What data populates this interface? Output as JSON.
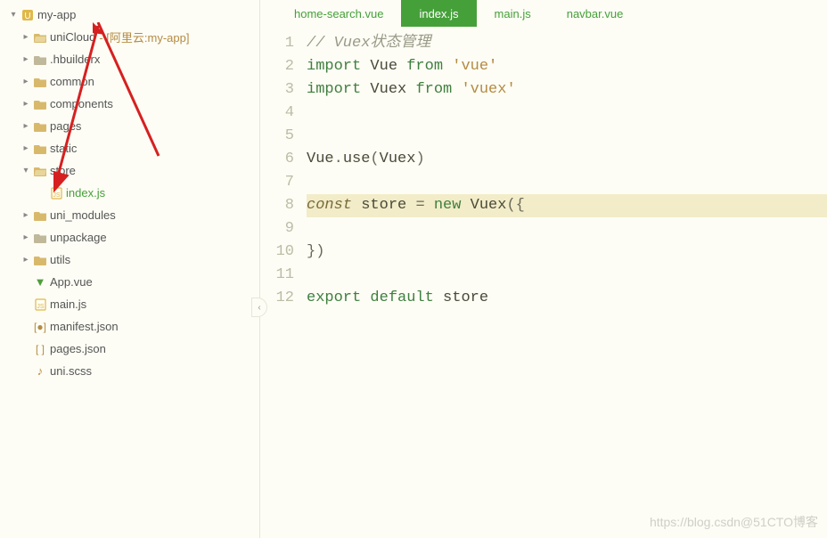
{
  "sidebar": {
    "root": {
      "label": "my-app"
    },
    "items": [
      {
        "label": "uniCloud",
        "suffix": " - [阿里云:my-app]",
        "type": "folder-open",
        "chev": "right"
      },
      {
        "label": ".hbuilderx",
        "type": "folder-grey",
        "chev": "right"
      },
      {
        "label": "common",
        "type": "folder",
        "chev": "right"
      },
      {
        "label": "components",
        "type": "folder",
        "chev": "right"
      },
      {
        "label": "pages",
        "type": "folder",
        "chev": "right"
      },
      {
        "label": "static",
        "type": "folder",
        "chev": "right"
      },
      {
        "label": "store",
        "type": "folder-open",
        "chev": "down",
        "children": [
          {
            "label": "index.js",
            "type": "js",
            "active": true
          }
        ]
      },
      {
        "label": "uni_modules",
        "type": "folder",
        "chev": "right"
      },
      {
        "label": "unpackage",
        "type": "folder-grey",
        "chev": "right"
      },
      {
        "label": "utils",
        "type": "folder",
        "chev": "right"
      },
      {
        "label": "App.vue",
        "type": "vue"
      },
      {
        "label": "main.js",
        "type": "js"
      },
      {
        "label": "manifest.json",
        "type": "manifest"
      },
      {
        "label": "pages.json",
        "type": "json"
      },
      {
        "label": "uni.scss",
        "type": "scss"
      }
    ]
  },
  "tabs": [
    {
      "label": "home-search.vue",
      "active": false
    },
    {
      "label": "index.js",
      "active": true
    },
    {
      "label": "main.js",
      "active": false
    },
    {
      "label": "navbar.vue",
      "active": false
    }
  ],
  "code": {
    "highlight_line": 8,
    "lines": [
      {
        "n": 1,
        "tokens": [
          [
            "comment",
            "// Vuex状态管理"
          ]
        ]
      },
      {
        "n": 2,
        "tokens": [
          [
            "keyword",
            "import"
          ],
          [
            "space",
            " "
          ],
          [
            "ident",
            "Vue"
          ],
          [
            "space",
            " "
          ],
          [
            "keyword",
            "from"
          ],
          [
            "space",
            " "
          ],
          [
            "string",
            "'vue'"
          ]
        ]
      },
      {
        "n": 3,
        "tokens": [
          [
            "keyword",
            "import"
          ],
          [
            "space",
            " "
          ],
          [
            "ident",
            "Vuex"
          ],
          [
            "space",
            " "
          ],
          [
            "keyword",
            "from"
          ],
          [
            "space",
            " "
          ],
          [
            "string",
            "'vuex'"
          ]
        ]
      },
      {
        "n": 4,
        "tokens": []
      },
      {
        "n": 5,
        "tokens": []
      },
      {
        "n": 6,
        "tokens": [
          [
            "ident",
            "Vue"
          ],
          [
            "punct",
            "."
          ],
          [
            "ident",
            "use"
          ],
          [
            "punct",
            "("
          ],
          [
            "ident",
            "Vuex"
          ],
          [
            "punct",
            ")"
          ]
        ]
      },
      {
        "n": 7,
        "tokens": []
      },
      {
        "n": 8,
        "tokens": [
          [
            "const",
            "const"
          ],
          [
            "space",
            " "
          ],
          [
            "ident",
            "store"
          ],
          [
            "space",
            " "
          ],
          [
            "punct",
            "="
          ],
          [
            "space",
            " "
          ],
          [
            "keyword",
            "new"
          ],
          [
            "space",
            " "
          ],
          [
            "ident",
            "Vuex"
          ],
          [
            "punct",
            "({"
          ]
        ]
      },
      {
        "n": 9,
        "tokens": []
      },
      {
        "n": 10,
        "tokens": [
          [
            "punct",
            "})"
          ]
        ]
      },
      {
        "n": 11,
        "tokens": []
      },
      {
        "n": 12,
        "tokens": [
          [
            "keyword",
            "export"
          ],
          [
            "space",
            " "
          ],
          [
            "keyword",
            "default"
          ],
          [
            "space",
            " "
          ],
          [
            "ident",
            "store"
          ]
        ]
      }
    ]
  },
  "watermark": "https://blog.csdn@51CTO博客"
}
